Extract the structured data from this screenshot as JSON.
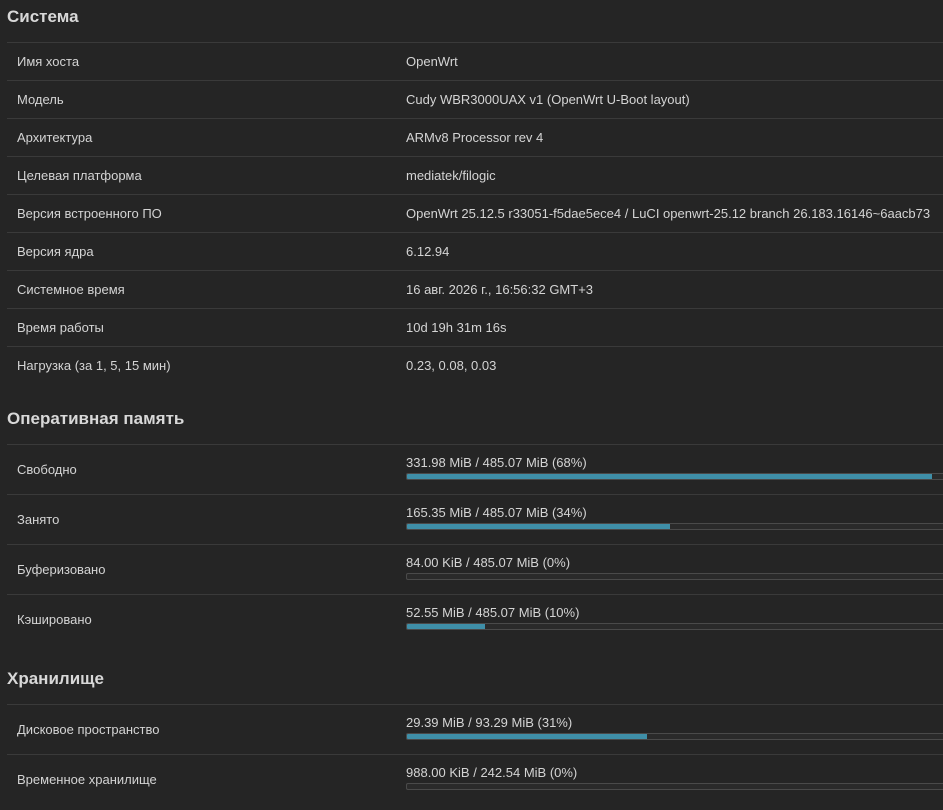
{
  "system": {
    "title": "Система",
    "rows": [
      {
        "label": "Имя хоста",
        "value": "OpenWrt"
      },
      {
        "label": "Модель",
        "value": "Cudy WBR3000UAX v1 (OpenWrt U-Boot layout)"
      },
      {
        "label": "Архитектура",
        "value": "ARMv8 Processor rev 4"
      },
      {
        "label": "Целевая платформа",
        "value": "mediatek/filogic"
      },
      {
        "label": "Версия встроенного ПО",
        "value": "OpenWrt 25.12.5 r33051-f5dae5ece4 / LuCI openwrt-25.12 branch 26.183.16146~6aacb73"
      },
      {
        "label": "Версия ядра",
        "value": "6.12.94"
      },
      {
        "label": "Системное время",
        "value": "16 авг. 2026 г., 16:56:32 GMT+3"
      },
      {
        "label": "Время работы",
        "value": "10d 19h 31m 16s"
      },
      {
        "label": "Нагрузка (за 1, 5, 15 мин)",
        "value": "0.23, 0.08, 0.03"
      }
    ]
  },
  "memory": {
    "title": "Оперативная память",
    "rows": [
      {
        "label": "Свободно",
        "value": "331.98 MiB / 485.07 MiB (68%)",
        "fraction": 0.98
      },
      {
        "label": "Занято",
        "value": "165.35 MiB / 485.07 MiB (34%)",
        "fraction": 0.49
      },
      {
        "label": "Буферизовано",
        "value": "84.00 KiB / 485.07 MiB (0%)",
        "fraction": 0.0
      },
      {
        "label": "Кэшировано",
        "value": "52.55 MiB / 485.07 MiB (10%)",
        "fraction": 0.145
      }
    ]
  },
  "storage": {
    "title": "Хранилище",
    "rows": [
      {
        "label": "Дисковое пространство",
        "value": "29.39 MiB / 93.29 MiB (31%)",
        "fraction": 0.447
      },
      {
        "label": "Временное хранилище",
        "value": "988.00 KiB / 242.54 MiB (0%)",
        "fraction": 0.0
      }
    ]
  },
  "colors": {
    "bar_fill": "#3f8fa8",
    "background": "#252525"
  }
}
